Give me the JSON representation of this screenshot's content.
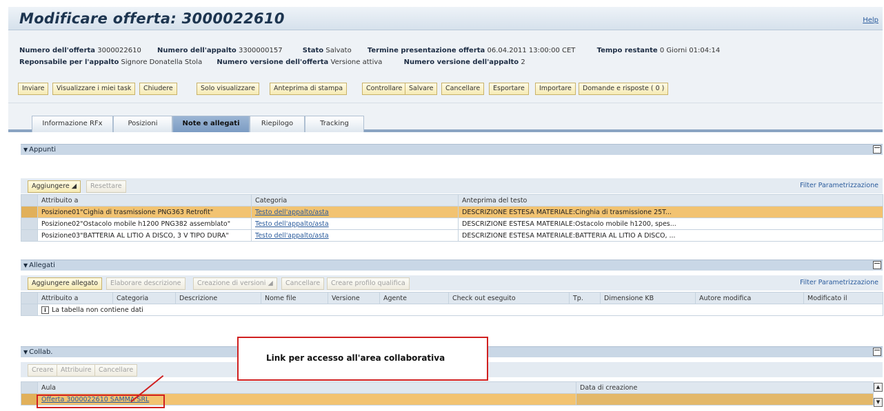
{
  "title": "Modificare offerta: 3000022610",
  "help": "Help",
  "header": {
    "line1": [
      {
        "label": "Numero dell'offerta",
        "value": "3000022610"
      },
      {
        "label": "Numero dell'appalto",
        "value": "3300000157"
      },
      {
        "label": "Stato",
        "value": "Salvato"
      },
      {
        "label": "Termine presentazione offerta",
        "value": "06.04.2011 13:00:00 CET"
      },
      {
        "label": "Tempo restante",
        "value": "0 Giorni 01:04:14"
      }
    ],
    "line2": [
      {
        "label": "Reponsabile per l'appalto",
        "value": "Signore Donatella Stola"
      },
      {
        "label": "Numero versione dell'offerta",
        "value": "Versione attiva"
      },
      {
        "label": "Numero versione dell'appalto",
        "value": "2"
      }
    ]
  },
  "actions": [
    "Inviare",
    "Visualizzare i miei task",
    "Chiudere",
    "Solo visualizzare",
    "Anteprima di stampa",
    "Controllare",
    "Salvare",
    "Cancellare",
    "Esportare",
    "Importare",
    "Domande e risposte ( 0 )"
  ],
  "tabs": [
    {
      "label": "Informazione RFx",
      "active": false
    },
    {
      "label": "Posizioni",
      "active": false
    },
    {
      "label": "Note e allegati",
      "active": true
    },
    {
      "label": "Riepilogo",
      "active": false
    },
    {
      "label": "Tracking",
      "active": false
    }
  ],
  "appunti": {
    "title": "Appunti",
    "buttons": [
      {
        "label": "Aggiungere",
        "enabled": true
      },
      {
        "label": "Resettare",
        "enabled": false
      }
    ],
    "filter": "Filter",
    "param": "Parametrizzazione",
    "columns": [
      "Attribuito a",
      "Categoria",
      "Anteprima del testo"
    ],
    "rows": [
      {
        "attr": "Posizione01\"Cighia di trasmissione PNG363 Retrofit\"",
        "cat": "Testo dell'appalto/asta",
        "preview": "DESCRIZIONE ESTESA MATERIALE:Cinghia di trasmissione 25T...",
        "highlight": true
      },
      {
        "attr": "Posizione02\"Ostacolo mobile h1200 PNG382 assemblato\"",
        "cat": "Testo dell'appalto/asta",
        "preview": "DESCRIZIONE ESTESA MATERIALE:Ostacolo mobile h1200, spes...",
        "highlight": false
      },
      {
        "attr": "Posizione03\"BATTERIA AL LITIO A DISCO, 3 V TIPO DURA\"",
        "cat": "Testo dell'appalto/asta",
        "preview": "DESCRIZIONE ESTESA MATERIALE:BATTERIA AL LITIO A DISCO, ...",
        "highlight": false
      }
    ]
  },
  "allegati": {
    "title": "Allegati",
    "buttons": [
      {
        "label": "Aggiungere allegato",
        "enabled": true
      },
      {
        "label": "Elaborare descrizione",
        "enabled": false
      },
      {
        "label": "Creazione di versioni",
        "enabled": false
      },
      {
        "label": "Cancellare",
        "enabled": false
      },
      {
        "label": "Creare profilo qualifica",
        "enabled": false
      }
    ],
    "filter": "Filter",
    "param": "Parametrizzazione",
    "columns": [
      "Attribuito a",
      "Categoria",
      "Descrizione",
      "Nome file",
      "Versione",
      "Agente",
      "Check out eseguito",
      "Tp.",
      "Dimensione KB",
      "Autore modifica",
      "Modificato il"
    ],
    "empty": "La tabella non contiene dati"
  },
  "collab": {
    "title": "Collab.",
    "buttons": [
      {
        "label": "Creare",
        "enabled": false
      },
      {
        "label": "Attribuire",
        "enabled": false
      },
      {
        "label": "Cancellare",
        "enabled": false
      }
    ],
    "columns": [
      "Aula",
      "Data di creazione"
    ],
    "row": {
      "aula": "Offerta 3000022610 SAMMA SRL",
      "data": ""
    }
  },
  "callout": "Link per accesso all'area collaborativa",
  "colors": {
    "highlight": "#f2c371",
    "callout_border": "#d02020",
    "section_header": "#c9d7e6"
  }
}
